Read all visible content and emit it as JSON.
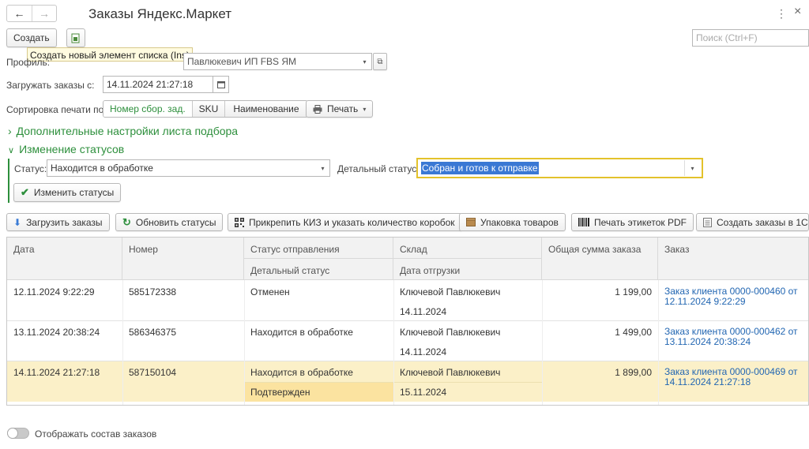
{
  "window": {
    "title": "Заказы Яндекс.Маркет",
    "menu_glyph": "⋮",
    "close_glyph": "×"
  },
  "toolbar": {
    "create_label": "Создать",
    "tooltip": "Создать новый элемент списка (Ins)",
    "search_placeholder": "Поиск (Ctrl+F)"
  },
  "form": {
    "profile_label": "Профиль:",
    "profile_value": "Павлюкевич ИП FBS ЯМ",
    "load_from_label": "Загружать заказы с:",
    "load_from_value": "14.11.2024 21:27:18",
    "sort_label": "Сортировка печати по:",
    "sort_options": [
      "Номер сбор. зад.",
      "SKU",
      "Наименование"
    ],
    "print_label": "Печать",
    "extra_settings_label": "Дополнительные настройки листа подбора",
    "status_change_label": "Изменение статусов",
    "status_label": "Статус:",
    "status_value": "Находится в обработке",
    "detail_status_label": "Детальный статус:",
    "detail_status_value": "Собран и готов к отправке",
    "change_status_button": "Изменить статусы"
  },
  "actions": {
    "load_orders": "Загрузить заказы",
    "refresh_statuses": "Обновить статусы",
    "attach_kiz": "Прикрепить КИЗ и указать количество коробок",
    "packing": "Упаковка товаров",
    "print_labels": "Печать этикеток PDF",
    "create_orders": "Создать заказы в 1С"
  },
  "table": {
    "headers": {
      "date": "Дата",
      "number": "Номер",
      "ship_status": "Статус отправления",
      "detail_status": "Детальный статус",
      "warehouse": "Склад",
      "ship_date": "Дата отгрузки",
      "total": "Общая сумма заказа",
      "order": "Заказ"
    },
    "rows": [
      {
        "date": "12.11.2024 9:22:29",
        "number": "585172338",
        "status": "Отменен",
        "detail": "",
        "warehouse": "Ключевой Павлюкевич",
        "ship_date": "14.11.2024",
        "total": "1 199,00",
        "order_line1": "Заказ клиента 0000-000460 от",
        "order_line2": "12.11.2024 9:22:29"
      },
      {
        "date": "13.11.2024 20:38:24",
        "number": "586346375",
        "status": "Находится в обработке",
        "detail": "",
        "warehouse": "Ключевой Павлюкевич",
        "ship_date": "14.11.2024",
        "total": "1 499,00",
        "order_line1": "Заказ клиента 0000-000462 от",
        "order_line2": "13.11.2024 20:38:24"
      },
      {
        "date": "14.11.2024 21:27:18",
        "number": "587150104",
        "status": "Находится в обработке",
        "detail": "Подтвержден",
        "warehouse": "Ключевой Павлюкевич",
        "ship_date": "15.11.2024",
        "total": "1 899,00",
        "order_line1": "Заказ клиента 0000-000469 от",
        "order_line2": "14.11.2024 21:27:18"
      }
    ]
  },
  "footer": {
    "toggle_label": "Отображать состав заказов"
  },
  "colors": {
    "accent_green": "#2d8f3c",
    "link_blue": "#2266b2",
    "selected_row": "#fbf0c8",
    "selected_cell": "#fbe3a0",
    "focus_border": "#e3c22b",
    "selection_bg": "#3a78d4"
  }
}
